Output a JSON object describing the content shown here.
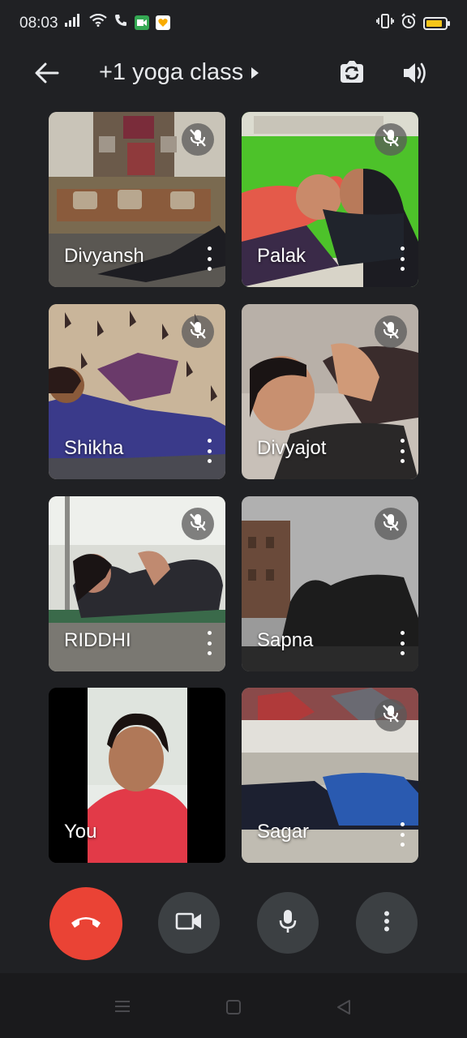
{
  "status_bar": {
    "time": "08:03",
    "battery_level": 0.75,
    "colors": {
      "battery_fill": "#f5c518",
      "meet_app": "#34a853",
      "other_app": "#f9ab00"
    }
  },
  "header": {
    "title": "+1 yoga class",
    "icons": [
      "back-arrow-icon",
      "switch-camera-icon",
      "speaker-icon"
    ]
  },
  "participants": [
    {
      "name": "Divyansh",
      "muted": true
    },
    {
      "name": "Palak",
      "muted": true
    },
    {
      "name": "Shikha",
      "muted": true
    },
    {
      "name": "Divyajot",
      "muted": true
    },
    {
      "name": "RIDDHI",
      "muted": true
    },
    {
      "name": "Sapna",
      "muted": true
    },
    {
      "name": "You",
      "muted": false
    },
    {
      "name": "Sagar",
      "muted": true
    }
  ],
  "controls": {
    "icons": [
      "end-call-icon",
      "camera-icon",
      "microphone-icon",
      "more-options-icon"
    ],
    "colors": {
      "end_call": "#ea4335",
      "button_bg": "#3c4043"
    }
  },
  "navigation": {
    "icons": [
      "menu-icon",
      "home-icon",
      "back-icon"
    ]
  }
}
